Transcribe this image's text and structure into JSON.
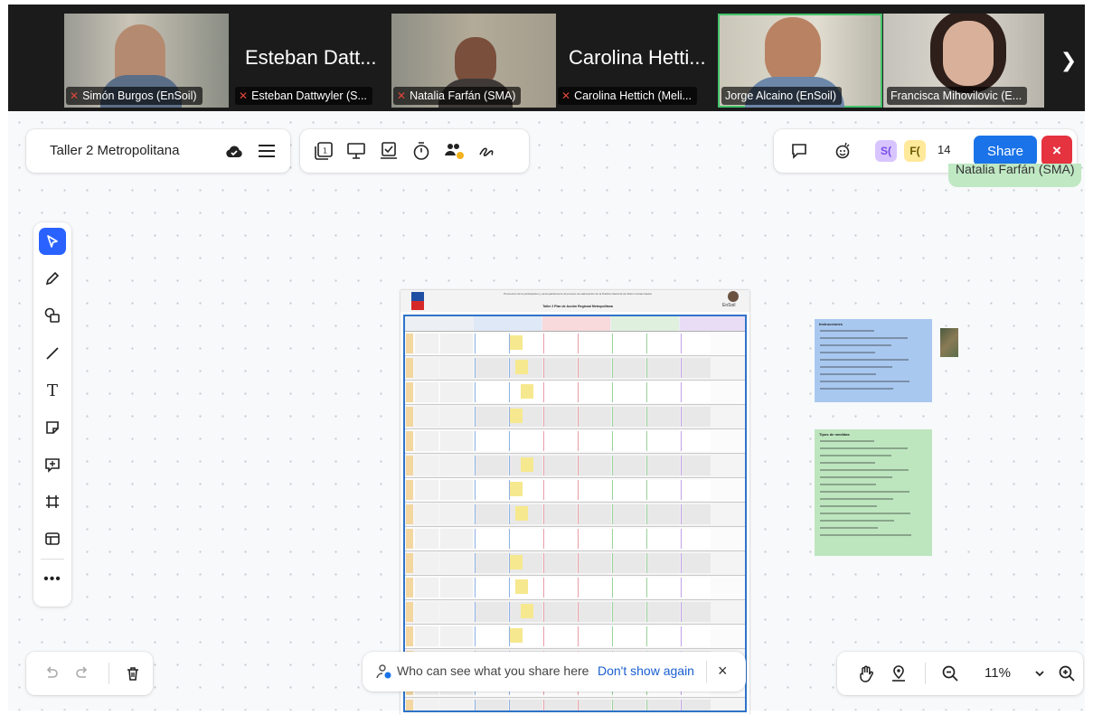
{
  "participants": [
    {
      "name": "Simón Burgos (EnSoil)",
      "muted": true,
      "video": true
    },
    {
      "name": "Esteban Dattwyler (S...",
      "muted": true,
      "video": false,
      "display_name": "Esteban Datt..."
    },
    {
      "name": "Natalia Farfán (SMA)",
      "muted": true,
      "video": true
    },
    {
      "name": "Carolina Hettich (Meli...",
      "muted": true,
      "video": false,
      "display_name": "Carolina Hetti..."
    },
    {
      "name": "Jorge Alcaino (EnSoil)",
      "muted": false,
      "video": true,
      "active_speaker": true
    },
    {
      "name": "Francisca Mihovilovic (E...",
      "muted": false,
      "video": true
    }
  ],
  "strip_next_icon": "chevron-right-icon",
  "board": {
    "title": "Taller 2 Metropolitana",
    "cloud_icon": "cloud-saved-icon",
    "menu_icon": "hamburger-menu-icon"
  },
  "tools": [
    "frames-icon",
    "presentation-icon",
    "voting-icon",
    "timer-icon",
    "collaboration-icon",
    "pen-tool-icon"
  ],
  "right": {
    "comment_icon": "comment-icon",
    "reaction_icon": "celebrate-icon",
    "avatars": [
      {
        "label": "S(",
        "bg": "#d8c5ff",
        "fg": "#7a4de6"
      },
      {
        "label": "F(",
        "bg": "#ffe99a",
        "fg": "#6b5a00"
      }
    ],
    "count": "14",
    "share_label": "Share",
    "close_label": "×"
  },
  "cursor_label": "Natalia Farfán (SMA)",
  "left_tools": [
    "select-icon",
    "pen-icon",
    "shapes-icon",
    "line-icon",
    "text-icon",
    "sticky-note-icon",
    "comment-add-icon",
    "frame-icon",
    "template-icon",
    "more-icon"
  ],
  "undo_panel": {
    "undo_icon": "undo-icon",
    "redo_icon": "redo-icon",
    "trash_icon": "trash-icon"
  },
  "toast": {
    "text": "Who can see what you share here",
    "link": "Don't show again",
    "close": "×"
  },
  "zoom": {
    "value": "11%",
    "hand_icon": "hand-icon",
    "map_icon": "map-pin-icon",
    "zoom_out_icon": "zoom-out-icon",
    "zoom_in_icon": "zoom-in-icon",
    "dropdown_icon": "chevron-down-icon"
  },
  "document": {
    "heading": "Promoción de la participación y acompañamiento al proceso de elaboración de la Política Nacional de Sitios Contaminados",
    "subheading": "Taller 2 Plan de Acción Regional Metropolitana",
    "logo": "EnSoil"
  },
  "notes": {
    "blue_title": "Instrucciones",
    "green_title": "Tipos de medidas"
  }
}
